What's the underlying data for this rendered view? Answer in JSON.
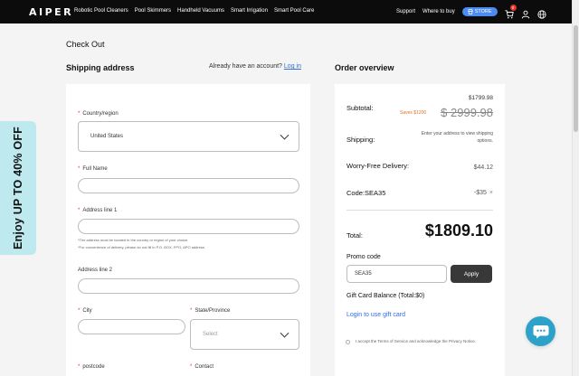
{
  "nav": {
    "logo": "AIPER",
    "links": [
      "Robotic Pool Cleaners",
      "Pool Skimmers",
      "Handheld Vacuums",
      "Smart Irrigation",
      "Smart Pool Care"
    ],
    "support": "Support",
    "where_to_buy": "Where to buy",
    "store_label": "STORE",
    "cart_count": "0"
  },
  "promo_tab": {
    "text": "Enjoy UP TO 40% OFF"
  },
  "page": {
    "title": "Check Out",
    "shipping_title": "Shipping address",
    "account_question": "Already have an account?",
    "login_link": "Log in",
    "order_title": "Order overview"
  },
  "form": {
    "country_label": "Country/region",
    "country_value": "United States",
    "fullname_label": "Full Name",
    "address1_label": "Address line 1",
    "address_note_1": "*The address must be located in the country or region of your choice.",
    "address_note_2": "*For convenience of delivery, please do not fill in P.O. BOX, FPO, APO address.",
    "address2_label": "Address line 2",
    "city_label": "City",
    "state_label": "State/Province",
    "state_placeholder": "Select",
    "postcode_label": "postcode",
    "contact_label": "Contact"
  },
  "order": {
    "subtotal_label": "Subtotal:",
    "subtotal_price": "$1799.98",
    "saves": "Saves $1200",
    "original_price": "$ 2999.98",
    "shipping_label": "Shipping:",
    "shipping_note": "Enter your address to view shipping options.",
    "warranty_label": "Worry-Free Delivery:",
    "warranty_price": "$44.12",
    "code_label": "Code:SEA35",
    "code_discount": "-$35",
    "total_label": "Total:",
    "total_value": "$1809.10",
    "promo_label": "Promo code",
    "promo_value": "SEA35",
    "apply_label": "Apply",
    "gift_balance": "Gift Card Balance (Total:$0)",
    "gift_link": "Login to use gift card",
    "terms": "I accept the Terms of Service and acknowledge the Privacy Notice."
  },
  "colors": {
    "nav_bg": "#0c0c0c",
    "accent_blue": "#2f6ede",
    "store_pill": "#4c8cf0",
    "promo_tab": "#bde9ef",
    "saves_orange": "#e2722d",
    "chat_button": "#2da2c8",
    "apply_button": "#383838"
  },
  "icons": {
    "cart": "cart-icon",
    "account": "user-icon",
    "language": "globe-icon",
    "chat": "chat-bubble-icon",
    "select_arrow": "chevron-down-icon"
  }
}
